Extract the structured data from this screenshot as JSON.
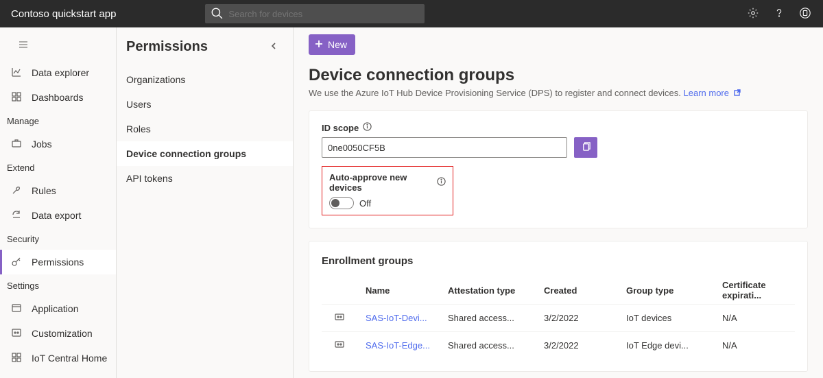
{
  "app_title": "Contoso quickstart app",
  "search": {
    "placeholder": "Search for devices"
  },
  "leftnav": {
    "items": [
      {
        "label": "Data explorer"
      },
      {
        "label": "Dashboards"
      }
    ],
    "section_manage": "Manage",
    "items_manage": [
      {
        "label": "Jobs"
      }
    ],
    "section_extend": "Extend",
    "items_extend": [
      {
        "label": "Rules"
      },
      {
        "label": "Data export"
      }
    ],
    "section_security": "Security",
    "items_security": [
      {
        "label": "Permissions"
      }
    ],
    "section_settings": "Settings",
    "items_settings": [
      {
        "label": "Application"
      },
      {
        "label": "Customization"
      },
      {
        "label": "IoT Central Home"
      }
    ]
  },
  "subnav": {
    "title": "Permissions",
    "items": [
      {
        "label": "Organizations"
      },
      {
        "label": "Users"
      },
      {
        "label": "Roles"
      },
      {
        "label": "Device connection groups"
      },
      {
        "label": "API tokens"
      }
    ]
  },
  "toolbar": {
    "new_label": "New"
  },
  "page": {
    "heading": "Device connection groups",
    "subtext": "We use the Azure IoT Hub Device Provisioning Service (DPS) to register and connect devices. ",
    "learn_more": "Learn more"
  },
  "idscope": {
    "label": "ID scope",
    "value": "0ne0050CF5B"
  },
  "auto_approve": {
    "label": "Auto-approve new devices",
    "state_label": "Off"
  },
  "enrollment": {
    "title": "Enrollment groups",
    "columns": {
      "name": "Name",
      "attestation": "Attestation type",
      "created": "Created",
      "grouptype": "Group type",
      "cert": "Certificate expirati..."
    },
    "rows": [
      {
        "name": "SAS-IoT-Devi...",
        "attestation": "Shared access...",
        "created": "3/2/2022",
        "grouptype": "IoT devices",
        "cert": "N/A"
      },
      {
        "name": "SAS-IoT-Edge...",
        "attestation": "Shared access...",
        "created": "3/2/2022",
        "grouptype": "IoT Edge devi...",
        "cert": "N/A"
      }
    ]
  }
}
